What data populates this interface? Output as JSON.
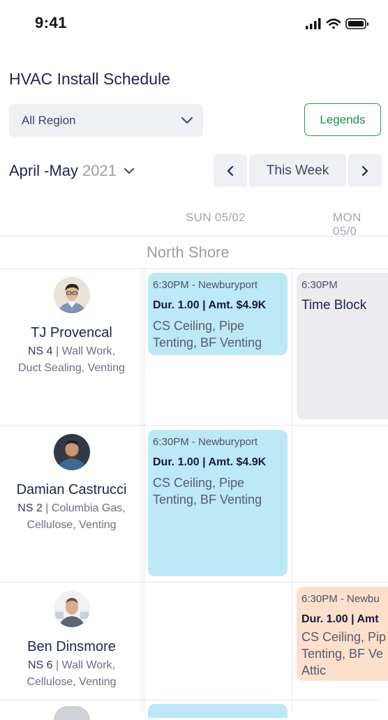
{
  "status": {
    "time": "9:41"
  },
  "header": {
    "title": "HVAC Install Schedule"
  },
  "filters": {
    "region_label": "All Region",
    "legends_label": "Legends"
  },
  "date_nav": {
    "range_label": "April -May",
    "year": "2021",
    "this_week_label": "This Week"
  },
  "days": [
    "SUN 05/02",
    "MON 05/0"
  ],
  "section": "North Shore",
  "people": [
    {
      "name": "TJ Provencal",
      "code": "NS 4",
      "desc_line1": " | Wall Work,",
      "desc_line2": "Duct Sealing, Venting",
      "events": [
        {
          "time": "6:30PM - Newburyport",
          "duration": "Dur. 1.00 | Amt. $4.9K",
          "services": "CS Ceiling, Pipe Tenting, BF Venting"
        },
        {
          "time": "6:30PM",
          "label": "Time Block"
        }
      ]
    },
    {
      "name": "Damian Castrucci",
      "code": "NS 2",
      "desc_line1": " | Columbia Gas,",
      "desc_line2": "Cellulose, Venting",
      "events": [
        {
          "time": "6:30PM - Newburyport",
          "duration": "Dur. 1.00 | Amt. $4.9K",
          "services": "CS Ceiling, Pipe Tenting, BF Venting"
        }
      ]
    },
    {
      "name": "Ben Dinsmore",
      "code": "NS 6",
      "desc_line1": " | Wall Work,",
      "desc_line2": "Cellulose, Venting",
      "events": [
        {
          "time": "6:30PM - Newbu",
          "duration": "Dur. 1.00 | Amt",
          "services": "CS Ceiling, Pip Tenting, BF Ve Attic"
        }
      ]
    }
  ],
  "colors": {
    "event_blue": "#bde9f7",
    "event_gray": "#ececef",
    "event_peach": "#fde0cc",
    "accent_green": "#1e8f45",
    "title_navy": "#1e2452"
  }
}
